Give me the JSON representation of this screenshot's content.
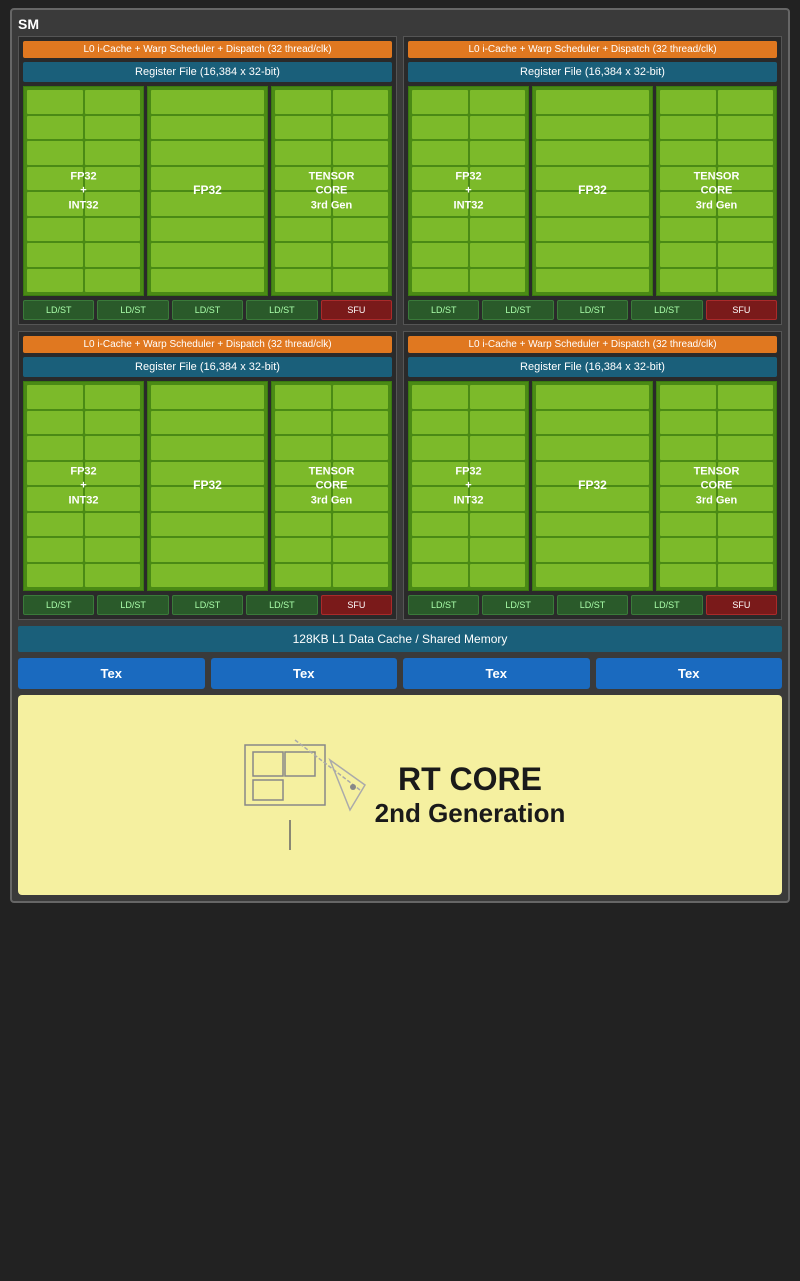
{
  "sm": {
    "label": "SM",
    "sub_units": [
      {
        "id": "sub1",
        "l0_cache": "L0 i-Cache + Warp Scheduler + Dispatch (32 thread/clk)",
        "register_file": "Register File (16,384 x 32-bit)",
        "fp32_int32_label": "FP32\n+\nINT32",
        "fp32_label": "FP32",
        "tensor_label": "TENSOR\nCORE\n3rd Gen",
        "ldst_labels": [
          "LD/ST",
          "LD/ST",
          "LD/ST",
          "LD/ST"
        ],
        "sfu_label": "SFU"
      },
      {
        "id": "sub2",
        "l0_cache": "L0 i-Cache + Warp Scheduler + Dispatch (32 thread/clk)",
        "register_file": "Register File (16,384 x 32-bit)",
        "fp32_int32_label": "FP32\n+\nINT32",
        "fp32_label": "FP32",
        "tensor_label": "TENSOR\nCORE\n3rd Gen",
        "ldst_labels": [
          "LD/ST",
          "LD/ST",
          "LD/ST",
          "LD/ST"
        ],
        "sfu_label": "SFU"
      },
      {
        "id": "sub3",
        "l0_cache": "L0 i-Cache + Warp Scheduler + Dispatch (32 thread/clk)",
        "register_file": "Register File (16,384 x 32-bit)",
        "fp32_int32_label": "FP32\n+\nINT32",
        "fp32_label": "FP32",
        "tensor_label": "TENSOR\nCORE\n3rd Gen",
        "ldst_labels": [
          "LD/ST",
          "LD/ST",
          "LD/ST",
          "LD/ST"
        ],
        "sfu_label": "SFU"
      },
      {
        "id": "sub4",
        "l0_cache": "L0 i-Cache + Warp Scheduler + Dispatch (32 thread/clk)",
        "register_file": "Register File (16,384 x 32-bit)",
        "fp32_int32_label": "FP32\n+\nINT32",
        "fp32_label": "FP32",
        "tensor_label": "TENSOR\nCORE\n3rd Gen",
        "ldst_labels": [
          "LD/ST",
          "LD/ST",
          "LD/ST",
          "LD/ST"
        ],
        "sfu_label": "SFU"
      }
    ],
    "l1_cache_label": "128KB L1 Data Cache / Shared Memory",
    "tex_labels": [
      "Tex",
      "Tex",
      "Tex",
      "Tex"
    ],
    "rt_core": {
      "line1": "RT CORE",
      "line2": "2nd Generation"
    }
  }
}
